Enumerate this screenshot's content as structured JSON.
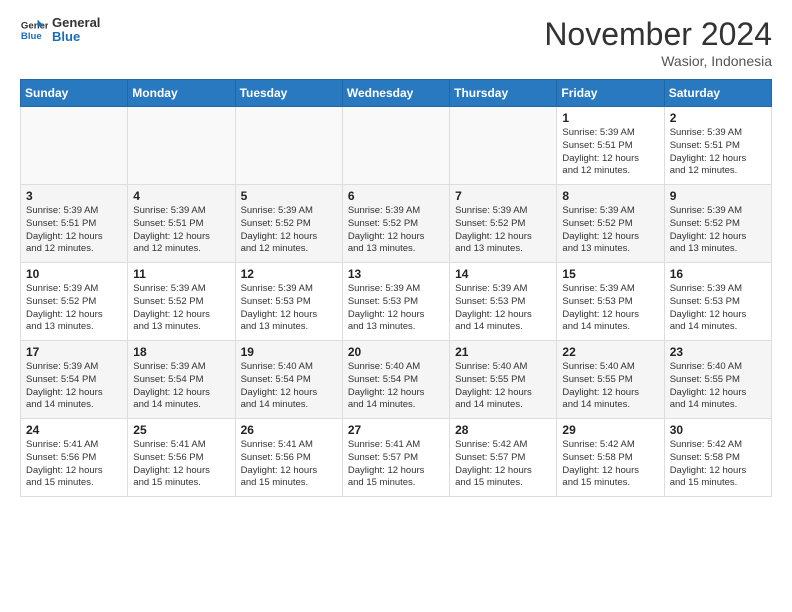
{
  "logo": {
    "line1": "General",
    "line2": "Blue"
  },
  "title": "November 2024",
  "location": "Wasior, Indonesia",
  "weekdays": [
    "Sunday",
    "Monday",
    "Tuesday",
    "Wednesday",
    "Thursday",
    "Friday",
    "Saturday"
  ],
  "weeks": [
    [
      {
        "day": "",
        "info": ""
      },
      {
        "day": "",
        "info": ""
      },
      {
        "day": "",
        "info": ""
      },
      {
        "day": "",
        "info": ""
      },
      {
        "day": "",
        "info": ""
      },
      {
        "day": "1",
        "info": "Sunrise: 5:39 AM\nSunset: 5:51 PM\nDaylight: 12 hours\nand 12 minutes."
      },
      {
        "day": "2",
        "info": "Sunrise: 5:39 AM\nSunset: 5:51 PM\nDaylight: 12 hours\nand 12 minutes."
      }
    ],
    [
      {
        "day": "3",
        "info": "Sunrise: 5:39 AM\nSunset: 5:51 PM\nDaylight: 12 hours\nand 12 minutes."
      },
      {
        "day": "4",
        "info": "Sunrise: 5:39 AM\nSunset: 5:51 PM\nDaylight: 12 hours\nand 12 minutes."
      },
      {
        "day": "5",
        "info": "Sunrise: 5:39 AM\nSunset: 5:52 PM\nDaylight: 12 hours\nand 12 minutes."
      },
      {
        "day": "6",
        "info": "Sunrise: 5:39 AM\nSunset: 5:52 PM\nDaylight: 12 hours\nand 13 minutes."
      },
      {
        "day": "7",
        "info": "Sunrise: 5:39 AM\nSunset: 5:52 PM\nDaylight: 12 hours\nand 13 minutes."
      },
      {
        "day": "8",
        "info": "Sunrise: 5:39 AM\nSunset: 5:52 PM\nDaylight: 12 hours\nand 13 minutes."
      },
      {
        "day": "9",
        "info": "Sunrise: 5:39 AM\nSunset: 5:52 PM\nDaylight: 12 hours\nand 13 minutes."
      }
    ],
    [
      {
        "day": "10",
        "info": "Sunrise: 5:39 AM\nSunset: 5:52 PM\nDaylight: 12 hours\nand 13 minutes."
      },
      {
        "day": "11",
        "info": "Sunrise: 5:39 AM\nSunset: 5:52 PM\nDaylight: 12 hours\nand 13 minutes."
      },
      {
        "day": "12",
        "info": "Sunrise: 5:39 AM\nSunset: 5:53 PM\nDaylight: 12 hours\nand 13 minutes."
      },
      {
        "day": "13",
        "info": "Sunrise: 5:39 AM\nSunset: 5:53 PM\nDaylight: 12 hours\nand 13 minutes."
      },
      {
        "day": "14",
        "info": "Sunrise: 5:39 AM\nSunset: 5:53 PM\nDaylight: 12 hours\nand 14 minutes."
      },
      {
        "day": "15",
        "info": "Sunrise: 5:39 AM\nSunset: 5:53 PM\nDaylight: 12 hours\nand 14 minutes."
      },
      {
        "day": "16",
        "info": "Sunrise: 5:39 AM\nSunset: 5:53 PM\nDaylight: 12 hours\nand 14 minutes."
      }
    ],
    [
      {
        "day": "17",
        "info": "Sunrise: 5:39 AM\nSunset: 5:54 PM\nDaylight: 12 hours\nand 14 minutes."
      },
      {
        "day": "18",
        "info": "Sunrise: 5:39 AM\nSunset: 5:54 PM\nDaylight: 12 hours\nand 14 minutes."
      },
      {
        "day": "19",
        "info": "Sunrise: 5:40 AM\nSunset: 5:54 PM\nDaylight: 12 hours\nand 14 minutes."
      },
      {
        "day": "20",
        "info": "Sunrise: 5:40 AM\nSunset: 5:54 PM\nDaylight: 12 hours\nand 14 minutes."
      },
      {
        "day": "21",
        "info": "Sunrise: 5:40 AM\nSunset: 5:55 PM\nDaylight: 12 hours\nand 14 minutes."
      },
      {
        "day": "22",
        "info": "Sunrise: 5:40 AM\nSunset: 5:55 PM\nDaylight: 12 hours\nand 14 minutes."
      },
      {
        "day": "23",
        "info": "Sunrise: 5:40 AM\nSunset: 5:55 PM\nDaylight: 12 hours\nand 14 minutes."
      }
    ],
    [
      {
        "day": "24",
        "info": "Sunrise: 5:41 AM\nSunset: 5:56 PM\nDaylight: 12 hours\nand 15 minutes."
      },
      {
        "day": "25",
        "info": "Sunrise: 5:41 AM\nSunset: 5:56 PM\nDaylight: 12 hours\nand 15 minutes."
      },
      {
        "day": "26",
        "info": "Sunrise: 5:41 AM\nSunset: 5:56 PM\nDaylight: 12 hours\nand 15 minutes."
      },
      {
        "day": "27",
        "info": "Sunrise: 5:41 AM\nSunset: 5:57 PM\nDaylight: 12 hours\nand 15 minutes."
      },
      {
        "day": "28",
        "info": "Sunrise: 5:42 AM\nSunset: 5:57 PM\nDaylight: 12 hours\nand 15 minutes."
      },
      {
        "day": "29",
        "info": "Sunrise: 5:42 AM\nSunset: 5:58 PM\nDaylight: 12 hours\nand 15 minutes."
      },
      {
        "day": "30",
        "info": "Sunrise: 5:42 AM\nSunset: 5:58 PM\nDaylight: 12 hours\nand 15 minutes."
      }
    ]
  ]
}
